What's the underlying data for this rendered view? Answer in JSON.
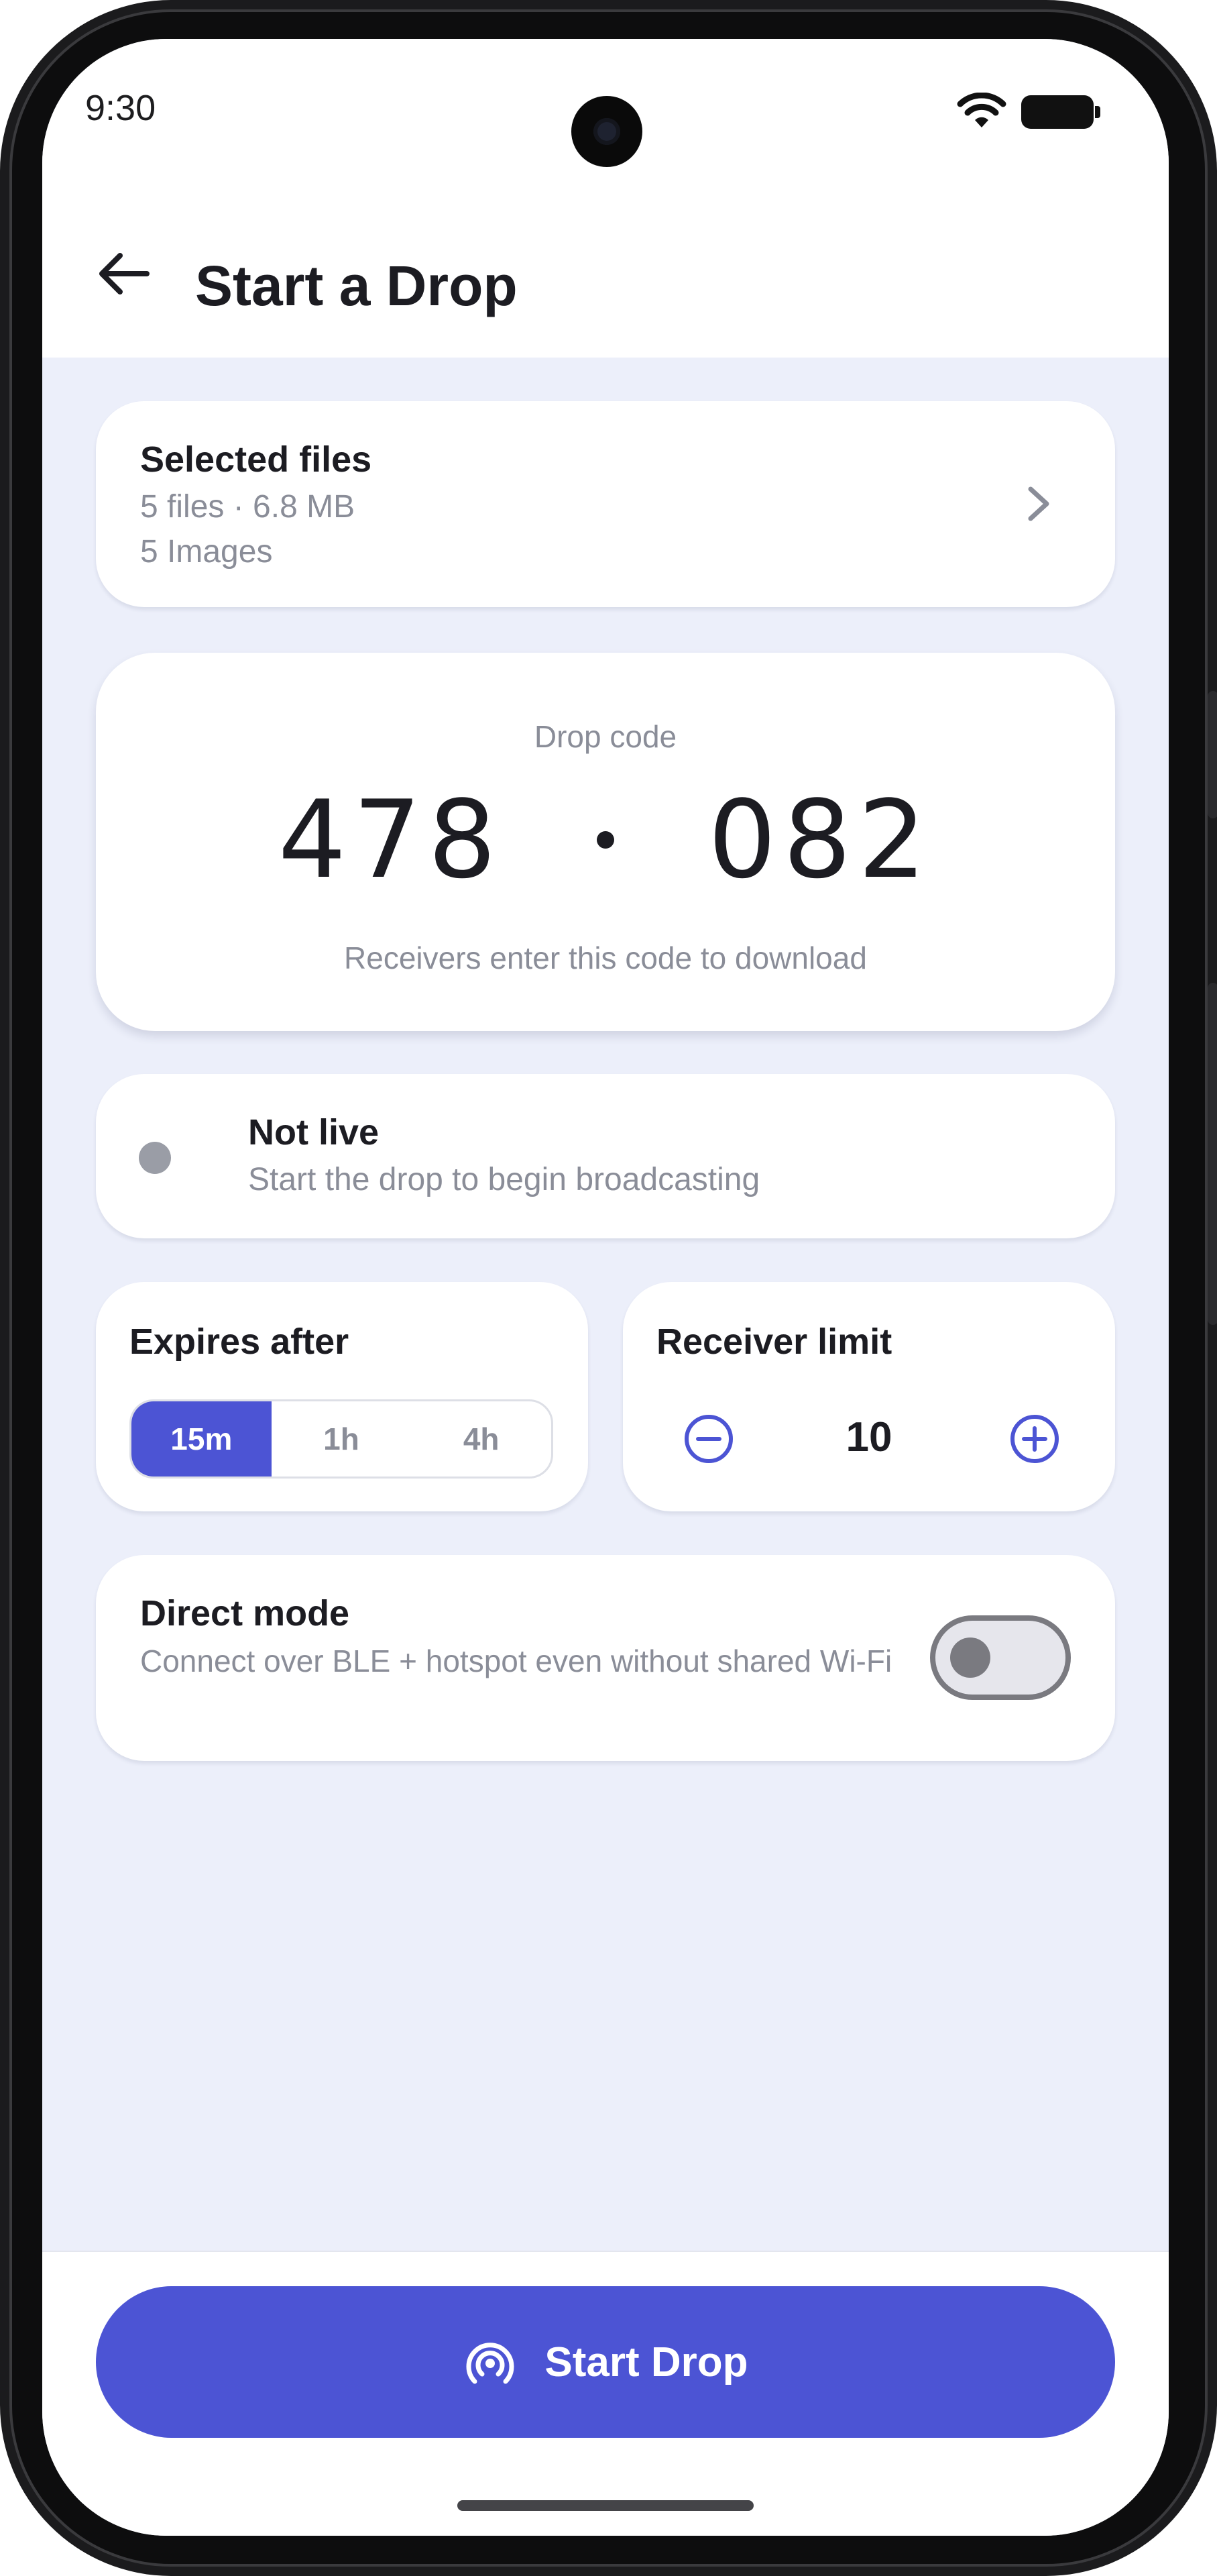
{
  "status_bar": {
    "time": "9:30",
    "icons": [
      "wifi-icon",
      "battery-icon",
      "camera-cutout"
    ]
  },
  "header": {
    "back_icon": "arrow-left-icon",
    "title": "Start a Drop"
  },
  "selected_files": {
    "title": "Selected files",
    "summary": "5 files · 6.8 MB",
    "types": "5 Images",
    "chevron_icon": "chevron-right-icon"
  },
  "drop_code": {
    "label": "Drop code",
    "part1": "478",
    "part2": "082",
    "hint": "Receivers enter this code to download"
  },
  "live_status": {
    "title": "Not live",
    "subtitle": "Start the drop to begin broadcasting",
    "dot_color": "#9a9da6"
  },
  "expires": {
    "title": "Expires after",
    "options": [
      "15m",
      "1h",
      "4h"
    ],
    "selected": "15m"
  },
  "receiver_limit": {
    "title": "Receiver limit",
    "value": "10",
    "minus_icon": "minus-circle-icon",
    "plus_icon": "plus-circle-icon"
  },
  "direct_mode": {
    "title": "Direct mode",
    "description": "Connect over BLE + hotspot even without shared Wi-Fi",
    "enabled": false
  },
  "action": {
    "label": "Start Drop",
    "icon": "broadcast-icon"
  },
  "colors": {
    "accent": "#4c54d4",
    "background": "#eceffa",
    "muted_text": "#8a8d98"
  }
}
